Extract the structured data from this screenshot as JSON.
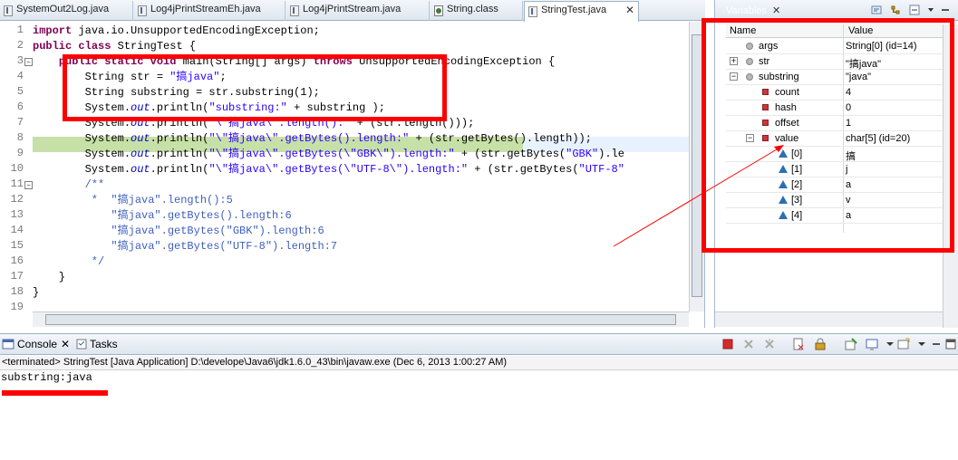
{
  "editor": {
    "tabs": [
      {
        "label": "SystemOut2Log.java",
        "icon": "java-file-icon"
      },
      {
        "label": "Log4jPrintStreamEh.java",
        "icon": "java-file-icon"
      },
      {
        "label": "Log4jPrintStream.java",
        "icon": "java-file-icon"
      },
      {
        "label": "String.class",
        "icon": "class-file-icon"
      },
      {
        "label": "StringTest.java",
        "icon": "java-file-icon",
        "active": true
      }
    ],
    "line_numbers": [
      "1",
      "2",
      "3",
      "4",
      "5",
      "6",
      "7",
      "8",
      "9",
      "10",
      "11",
      "12",
      "13",
      "14",
      "15",
      "16",
      "17",
      "18",
      "19"
    ],
    "code": [
      {
        "segments": [
          {
            "t": "import",
            "c": "kw"
          },
          {
            "t": " java.io.UnsupportedEncodingException;"
          }
        ]
      },
      {
        "segments": [
          {
            "t": "public",
            "c": "kw"
          },
          {
            "t": " "
          },
          {
            "t": "class",
            "c": "kw"
          },
          {
            "t": " StringTest {"
          }
        ]
      },
      {
        "segments": [
          {
            "t": "    "
          },
          {
            "t": "public",
            "c": "kw"
          },
          {
            "t": " "
          },
          {
            "t": "static",
            "c": "kw"
          },
          {
            "t": " "
          },
          {
            "t": "void",
            "c": "kw"
          },
          {
            "t": " main(String[] args) "
          },
          {
            "t": "throws",
            "c": "kw"
          },
          {
            "t": " UnsupportedEncodingException {"
          }
        ]
      },
      {
        "segments": [
          {
            "t": "        String str = "
          },
          {
            "t": "\"搞java\"",
            "c": "str"
          },
          {
            "t": ";"
          }
        ]
      },
      {
        "segments": [
          {
            "t": "        String substring = str.substring(1);"
          }
        ]
      },
      {
        "segments": [
          {
            "t": "        System."
          },
          {
            "t": "out",
            "c": "it"
          },
          {
            "t": ".println("
          },
          {
            "t": "\"substring:\"",
            "c": "str"
          },
          {
            "t": " + substring );"
          }
        ]
      },
      {
        "segments": [
          {
            "t": "        System."
          },
          {
            "t": "out",
            "c": "it"
          },
          {
            "t": ".println("
          },
          {
            "t": "\"\\\"搞java\\\".length():\"",
            "c": "str"
          },
          {
            "t": " + (str.length()));"
          }
        ]
      },
      {
        "segments": [
          {
            "t": "        System."
          },
          {
            "t": "out",
            "c": "it"
          },
          {
            "t": ".println("
          },
          {
            "t": "\"\\\"搞java\\\".getBytes().length:\"",
            "c": "str"
          },
          {
            "t": " + (str.getBytes().length));"
          }
        ]
      },
      {
        "segments": [
          {
            "t": "        System."
          },
          {
            "t": "out",
            "c": "it"
          },
          {
            "t": ".println("
          },
          {
            "t": "\"\\\"搞java\\\".getBytes(\\\"GBK\\\").length:\"",
            "c": "str"
          },
          {
            "t": " + (str.getBytes("
          },
          {
            "t": "\"GBK\"",
            "c": "str"
          },
          {
            "t": ").le"
          }
        ]
      },
      {
        "segments": [
          {
            "t": "        System."
          },
          {
            "t": "out",
            "c": "it"
          },
          {
            "t": ".println("
          },
          {
            "t": "\"\\\"搞java\\\".getBytes(\\\"UTF-8\\\").length:\"",
            "c": "str"
          },
          {
            "t": " + (str.getBytes("
          },
          {
            "t": "\"UTF-8\"",
            "c": "str"
          }
        ]
      },
      {
        "segments": [
          {
            "t": "        /**",
            "c": "cm"
          }
        ]
      },
      {
        "segments": [
          {
            "t": "         *  \"搞java\".length():5",
            "c": "cm"
          }
        ]
      },
      {
        "segments": [
          {
            "t": "            \"搞java\".getBytes().length:6",
            "c": "cm"
          }
        ]
      },
      {
        "segments": [
          {
            "t": "            \"搞java\".getBytes(\"GBK\").length:6",
            "c": "cm"
          }
        ]
      },
      {
        "segments": [
          {
            "t": "            \"搞java\".getBytes(\"UTF-8\").length:7",
            "c": "cm"
          }
        ]
      },
      {
        "segments": [
          {
            "t": "         */",
            "c": "cm"
          }
        ]
      },
      {
        "segments": [
          {
            "t": "    }"
          }
        ]
      },
      {
        "segments": [
          {
            "t": "}"
          }
        ]
      },
      {
        "segments": [
          {
            "t": ""
          }
        ]
      }
    ]
  },
  "variables": {
    "tab_label": "Variables",
    "columns": {
      "name": "Name",
      "value": "Value"
    },
    "rows": [
      {
        "name": "args",
        "value": "String[0]  (id=14)",
        "icon": "local-variable-icon",
        "toggle": ""
      },
      {
        "name": "str",
        "value": "\"搞java\"",
        "icon": "local-variable-icon",
        "toggle": "+"
      },
      {
        "name": "substring",
        "value": "\"java\"",
        "icon": "local-variable-icon",
        "toggle": "−"
      },
      {
        "name": "count",
        "value": "4",
        "icon": "field-icon",
        "toggle": ""
      },
      {
        "name": "hash",
        "value": "0",
        "icon": "field-icon",
        "toggle": ""
      },
      {
        "name": "offset",
        "value": "1",
        "icon": "field-icon",
        "toggle": ""
      },
      {
        "name": "value",
        "value": "char[5]  (id=20)",
        "icon": "field-icon",
        "toggle": "−"
      },
      {
        "name": "[0]",
        "value": "搞",
        "icon": "array-element-icon",
        "toggle": ""
      },
      {
        "name": "[1]",
        "value": "j",
        "icon": "array-element-icon",
        "toggle": ""
      },
      {
        "name": "[2]",
        "value": "a",
        "icon": "array-element-icon",
        "toggle": ""
      },
      {
        "name": "[3]",
        "value": "v",
        "icon": "array-element-icon",
        "toggle": ""
      },
      {
        "name": "[4]",
        "value": "a",
        "icon": "array-element-icon",
        "toggle": ""
      }
    ]
  },
  "console": {
    "tabs": [
      {
        "label": "Console",
        "icon": "console-icon",
        "active": true
      },
      {
        "label": "Tasks",
        "icon": "tasks-icon",
        "active": false
      }
    ],
    "description": "<terminated> StringTest [Java Application] D:\\develope\\Java6\\jdk1.6.0_43\\bin\\javaw.exe (Dec 6, 2013 1:00:27 AM)",
    "output": "substring:java"
  },
  "colors": {
    "annotation": "#ff0000",
    "keyword": "#7f0055",
    "string": "#2a00ff",
    "comment": "#3f5fbf",
    "static_field": "#0000c0"
  }
}
